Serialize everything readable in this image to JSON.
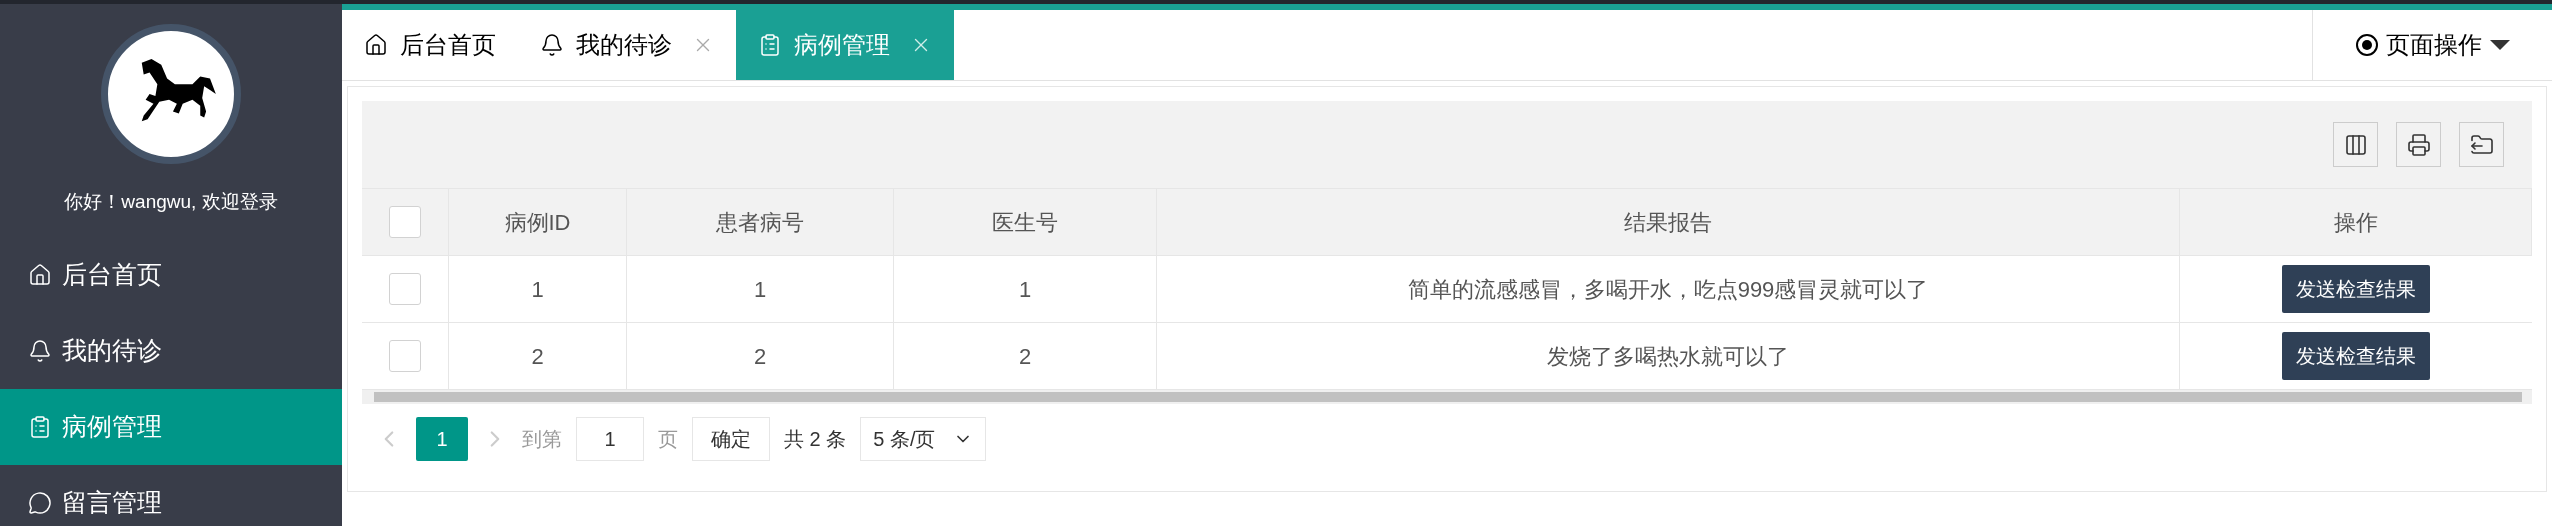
{
  "sidebar": {
    "greeting": "你好！wangwu, 欢迎登录",
    "items": [
      {
        "label": "后台首页",
        "selected": false
      },
      {
        "label": "我的待诊",
        "selected": false
      },
      {
        "label": "病例管理",
        "selected": true
      },
      {
        "label": "留言管理",
        "selected": false
      }
    ]
  },
  "tabs": [
    {
      "label": "后台首页",
      "selected": false,
      "closable": false
    },
    {
      "label": "我的待诊",
      "selected": false,
      "closable": true
    },
    {
      "label": "病例管理",
      "selected": true,
      "closable": true
    }
  ],
  "page_actions": "页面操作",
  "table": {
    "header_checked": false,
    "columns": [
      "病例ID",
      "患者病号",
      "医生号",
      "结果报告",
      "操作"
    ],
    "rows": [
      {
        "checked": false,
        "cells": [
          "1",
          "1",
          "1",
          "简单的流感感冒，多喝开水，吃点999感冒灵就可以了"
        ],
        "action": "发送检查结果"
      },
      {
        "checked": false,
        "cells": [
          "2",
          "2",
          "2",
          "发烧了多喝热水就可以了"
        ],
        "action": "发送检查结果"
      }
    ]
  },
  "pagination": {
    "pages": [
      {
        "label": "1",
        "selected": true
      }
    ],
    "goto_label": "到第",
    "page_input": "1",
    "page_suffix": "页",
    "confirm": "确定",
    "total": "共 2 条",
    "page_size": "5 条/页"
  }
}
